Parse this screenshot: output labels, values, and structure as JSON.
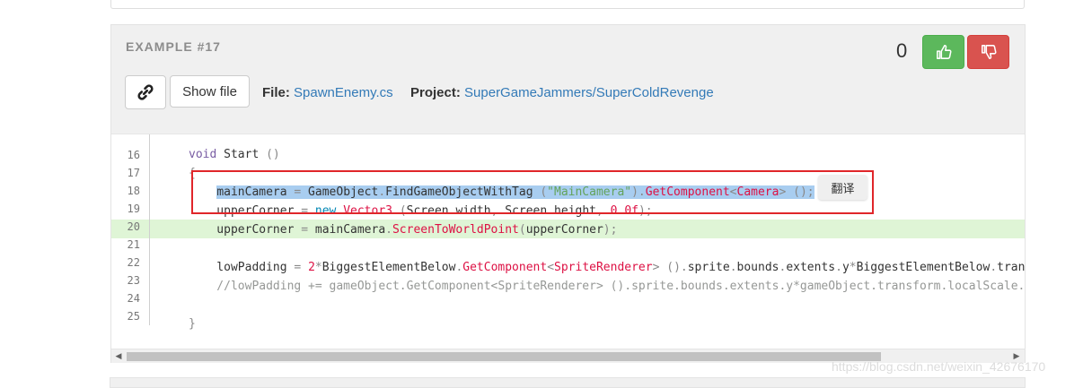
{
  "example": {
    "title": "EXAMPLE #17",
    "score": "0",
    "show_file_label": "Show file",
    "file_label": "File:",
    "file_name": "SpawnEnemy.cs",
    "project_label": "Project:",
    "project_name": "SuperGameJammers/SuperColdRevenge"
  },
  "icons": {
    "link": "link-icon",
    "thumbs_up": "thumbs-up-icon",
    "thumbs_down": "thumbs-down-icon",
    "scroll_left": "chevron-left-icon",
    "scroll_right": "chevron-right-icon"
  },
  "code": {
    "line_numbers": [
      "16",
      "17",
      "18",
      "19",
      "20",
      "21",
      "22",
      "23",
      "24",
      "25"
    ],
    "highlighted_line": "20",
    "translate_popup": "翻译"
  },
  "colors": {
    "upvote": "#5cb85c",
    "downvote": "#d9534f",
    "link": "#337ab7",
    "highlight_row": "#dff5d6",
    "selection": "#a8cdf0",
    "annotation_box": "#e0262a"
  },
  "watermark": "https://blog.csdn.net/weixin_42676170"
}
